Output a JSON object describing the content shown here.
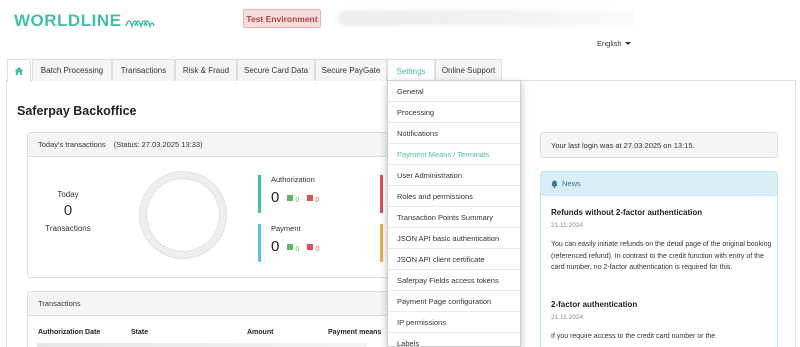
{
  "header": {
    "brand": "WORLDLINE",
    "environment_badge": "Test Environment",
    "language": "English"
  },
  "nav": {
    "tabs": [
      {
        "label": "Batch Processing"
      },
      {
        "label": "Transactions"
      },
      {
        "label": "Risk & Fraud"
      },
      {
        "label": "Secure Card Data"
      },
      {
        "label": "Secure PayGate"
      },
      {
        "label": "Settings"
      },
      {
        "label": "Online Support"
      }
    ]
  },
  "page": {
    "title": "Saferpay Backoffice"
  },
  "today": {
    "heading": "Today's transactions",
    "status": "(Status: 27.03.2025 13:33)",
    "label_top": "Today",
    "count": "0",
    "label_bottom": "Transactions",
    "metrics": [
      {
        "title": "Authorization",
        "value": "0",
        "ok": "0",
        "failed": "0"
      },
      {
        "title": "Payment",
        "value": "0",
        "ok": "0",
        "failed": "0"
      }
    ]
  },
  "transactions": {
    "heading": "Transactions",
    "columns": [
      "Authorization Date",
      "State",
      "Amount",
      "Payment means"
    ]
  },
  "settings_menu": {
    "items": [
      "General",
      "Processing",
      "Notifications",
      "Payment Means / Terminals",
      "User Administration",
      "Roles and permissions",
      "Transaction Points Summary",
      "JSON API basic authentication",
      "JSON API client certificate",
      "Saferpay Fields access tokens",
      "Payment Page configuration",
      "IP permissions",
      "Labels"
    ],
    "active_index": 3
  },
  "last_login": "Your last login was at 27.03.2025 on 13:15.",
  "news": {
    "heading": "News",
    "items": [
      {
        "title": "Refunds without 2-factor authentication",
        "date": "21.11.2024",
        "text": "You can easily initiate refunds on the detail page of the original booking (referenced refund). In contrast to the credit function with entry of the card number, no 2-factor authentication is required for this."
      },
      {
        "title": "2-factor authentication",
        "date": "21.11.2024",
        "text": "If you require access to the credit card number or the"
      }
    ]
  },
  "colors": {
    "brand": "#46beaa",
    "badge_bg": "#f8dcdc",
    "badge_text": "#a94442",
    "ok": "#5cb85c",
    "failed": "#d9534f",
    "news_head": "#d9edf7"
  }
}
